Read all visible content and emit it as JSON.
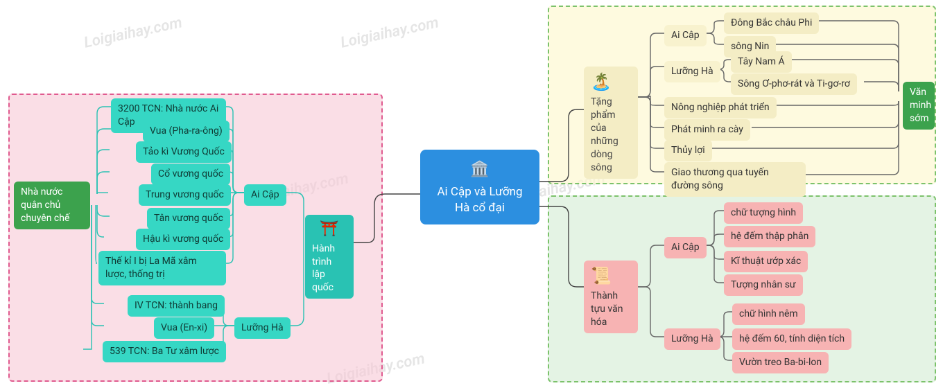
{
  "watermark": "Loigiaihay.com",
  "center": "Ai Cập và Lưỡng Hà cổ đại",
  "left": {
    "hub": "Hành trình lập quốc",
    "state_label": "Nhà nước quân chủ chuyên chế",
    "branches": {
      "aicap": {
        "label": "Ai Cập",
        "items": [
          "3200 TCN: Nhà nước Ai Cập",
          "Vua (Pha-ra-ông)",
          "Tảo kì Vương Quốc",
          "Cổ vương quốc",
          "Trung vương quốc",
          "Tân vương quốc",
          "Hậu kì vương quốc",
          "Thế kỉ I bị La Mã xâm lược, thống trị"
        ]
      },
      "luongha": {
        "label": "Lưỡng Hà",
        "items": [
          "IV TCN: thành bang",
          "Vua (En-xi)",
          "539 TCN: Ba Tư xâm lược"
        ]
      }
    }
  },
  "topright": {
    "hub": "Tặng phẩm của những dòng sông",
    "civ_label": "Văn minh sớm",
    "branches": {
      "aicap": {
        "label": "Ai Cập",
        "items": [
          "Đông Bắc châu Phi",
          "sông Nin"
        ]
      },
      "luongha": {
        "label": "Lưỡng Hà",
        "items": [
          "Tây Nam Á",
          "Sông Ơ-phơ-rát và Ti-gơ-rơ"
        ]
      }
    },
    "others": [
      "Nông nghiệp phát triển",
      "Phát minh ra cày",
      "Thủy lợi",
      "Giao thương qua tuyến đường sông"
    ]
  },
  "bottomright": {
    "hub": "Thành tựu văn hóa",
    "branches": {
      "aicap": {
        "label": "Ai Cập",
        "items": [
          "chữ tượng hình",
          "hệ đếm thập phân",
          "Kĩ thuật ướp xác",
          "Tượng nhân sư"
        ]
      },
      "luongha": {
        "label": "Lưỡng Hà",
        "items": [
          "chữ hình nêm",
          "hệ đếm 60, tính diện tích",
          "Vườn treo Ba-bi-lon"
        ]
      }
    }
  }
}
